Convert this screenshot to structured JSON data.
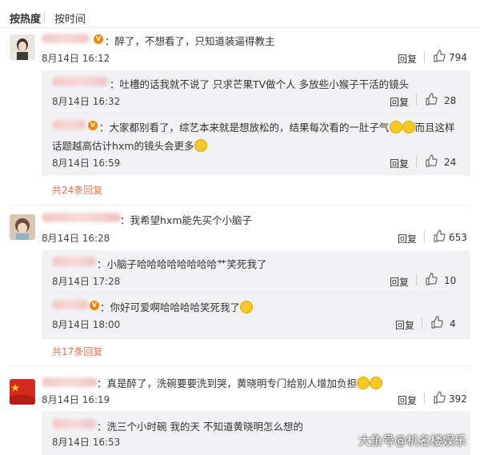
{
  "sort": {
    "active": "按热度",
    "other": "按时间"
  },
  "comments": [
    {
      "text": "：醉了，不想看了，只知道装逼得教主",
      "time": "8月14日 16:12",
      "reply_label": "回复",
      "likes": "794",
      "replies": [
        {
          "text": "：吐槽的话我就不说了  只求芒果TV做个人    多放些小猴子干活的镜头",
          "time": "8月14日 16:32",
          "reply_label": "回复",
          "likes": "28"
        },
        {
          "text_line1": "：大家都别看了，综艺本来就是想放松的，结果每次看的一肚子气",
          "text_line1_tail": "而且这样",
          "text_line2": "话题越高估计hxm的镜头会更多",
          "time": "8月14日 16:59",
          "reply_label": "回复",
          "likes": "24"
        }
      ],
      "more_label": "共24条回复"
    },
    {
      "text": "：我希望hxm能先买个小脑子",
      "time": "8月14日 16:28",
      "reply_label": "回复",
      "likes": "653",
      "replies": [
        {
          "text": "：小脑子哈哈哈哈哈哈哈哈艹笑死我了",
          "time": "8月14日 17:28",
          "reply_label": "回复",
          "likes": "10"
        },
        {
          "text": "：你好可爱啊哈哈哈哈笑死我了",
          "time": "8月14日 18:00",
          "reply_label": "回复",
          "likes": "4"
        }
      ],
      "more_label": "共17条回复"
    },
    {
      "text": "：真是醉了，洗碗要要洗到哭，黄晓明专门给别人增加负担",
      "time": "8月14日 16:19",
      "reply_label": "回复",
      "likes": "392",
      "replies": [
        {
          "text": "：洗三个小时碗 我的天 不知道黄晓明怎么想的",
          "time": "8月14日 16:53"
        }
      ]
    }
  ],
  "watermark": "大鱼号@机名楼娱乐",
  "colors": {
    "accent": "#eb7350",
    "subbox": "#f2f2f5"
  }
}
